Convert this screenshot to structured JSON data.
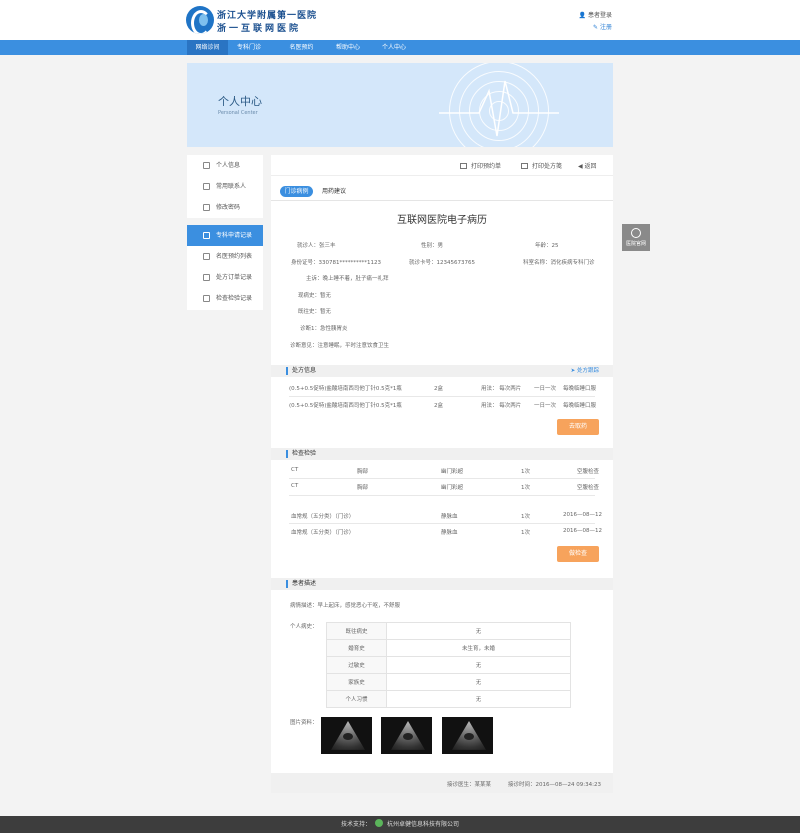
{
  "header": {
    "logo_line1": "浙江大学附属第一医院",
    "logo_line2": "浙一互联网医院",
    "login_label": "患者登录",
    "register_label": "注册"
  },
  "nav": [
    "网络诊间",
    "专科门诊",
    "名医预约",
    "帮助中心",
    "个人中心"
  ],
  "banner": {
    "title": "个人中心",
    "subtitle": "Personal Center"
  },
  "sidebar": {
    "group1": [
      "个人信息",
      "常用联系人",
      "修改密码"
    ],
    "group2": [
      "专科申请记录",
      "名医预约列表",
      "处方订单记录",
      "检查检验记录"
    ]
  },
  "toolbar": {
    "print_order": "打印预约单",
    "print_rx": "打印处方笺",
    "back": "返回"
  },
  "tabs": {
    "active": "门诊病例",
    "other": "用药建议"
  },
  "record": {
    "title": "互联网医院电子病历",
    "name_label": "就诊人：",
    "name": "张三丰",
    "gender_label": "性别：",
    "gender": "男",
    "age_label": "年龄：",
    "age": "25",
    "id_label": "身份证号：",
    "id": "330781**********1123",
    "card_label": "就诊卡号：",
    "card": "12345673765",
    "dept_label": "科室名称：",
    "dept": "消化疾病专科门诊",
    "complaint_label": "主诉：",
    "complaint": "晚上睡不着，肚子痛一礼拜",
    "present_label": "现病史：",
    "present": "暂无",
    "past_label": "既往史：",
    "past": "暂无",
    "diag_label": "诊断1：",
    "diag": "急性胰胃炎",
    "opinion_label": "诊断意见：",
    "opinion": "注意睡眠，平时注意饮食卫生"
  },
  "prescription": {
    "title": "处方信息",
    "track": "处方跟踪",
    "rows": [
      {
        "drug": "(0.5+0.5促特)盐酸培南西司他丁针0.5克*1瓶",
        "qty": "2盒",
        "usage": "用法： 每次两片",
        "freq": "一日一次",
        "route": "每晚临睡口服"
      },
      {
        "drug": "(0.5+0.5促特)盐酸培南西司他丁针0.5克*1瓶",
        "qty": "2盒",
        "usage": "用法： 每次两片",
        "freq": "一日一次",
        "route": "每晚临睡口服"
      }
    ],
    "button": "去取药"
  },
  "exam": {
    "title": "检查检验",
    "rows": [
      {
        "item": "CT",
        "part": "胸部",
        "method": "幽门彩超",
        "count": "1次",
        "status": "空腹检查"
      },
      {
        "item": "CT",
        "part": "胸部",
        "method": "幽门彩超",
        "count": "1次",
        "status": "空腹检查"
      },
      {
        "item": "血常规（五分类）（门诊）",
        "part": "",
        "method": "静脉血",
        "count": "1次",
        "status": "2016—08—12"
      },
      {
        "item": "血常规（五分类）（门诊）",
        "part": "",
        "method": "静脉血",
        "count": "1次",
        "status": "2016—08—12"
      }
    ],
    "button": "做检查"
  },
  "patient": {
    "title": "患者描述",
    "desc_label": "病情描述：",
    "desc": "早上起床，感觉恶心干呕，不舒服",
    "history_label": "个人病史：",
    "history": [
      {
        "k": "既往病史",
        "v": "无"
      },
      {
        "k": "婚育史",
        "v": "未生育，未婚"
      },
      {
        "k": "过敏史",
        "v": "无"
      },
      {
        "k": "家族史",
        "v": "无"
      },
      {
        "k": "个人习惯",
        "v": "无"
      }
    ],
    "images_label": "图片资料："
  },
  "main_footer": {
    "doctor_label": "接诊医生：",
    "doctor": "某某某",
    "time_label": "接诊时间：",
    "time": "2016—08—24  09:34:23"
  },
  "float_button": "医院官网",
  "footer": {
    "label": "技术支持：",
    "company": "杭州卓健信息科技有限公司"
  },
  "colors": {
    "primary": "#3b8fe0",
    "accent": "#f7a35c",
    "footer": "#3d3d3d"
  }
}
